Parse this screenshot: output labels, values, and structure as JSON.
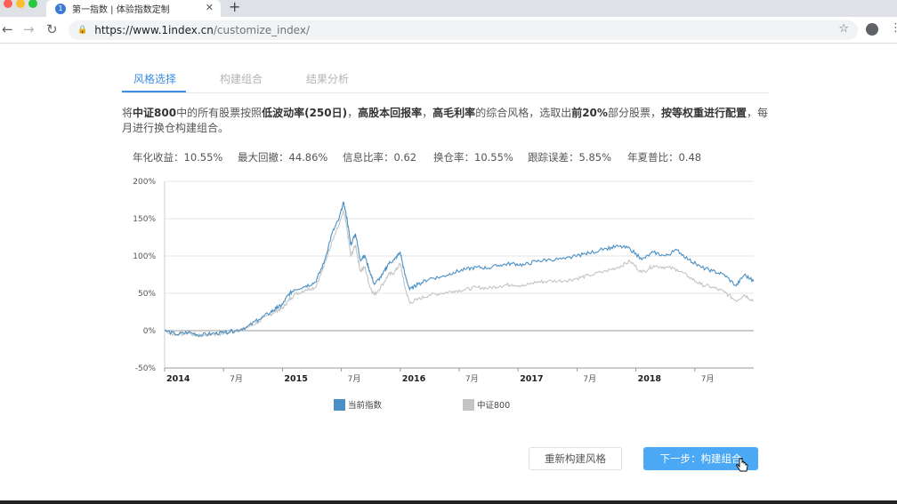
{
  "browser": {
    "tab_title": "第一指数 | 体验指数定制",
    "favicon_letter": "1",
    "new_tab": "+",
    "close": "✕",
    "url_host": "https://www.1index.cn",
    "url_path": "/customize_index/"
  },
  "page_tabs": [
    {
      "label": "风格选择",
      "active": true
    },
    {
      "label": "构建组合",
      "active": false
    },
    {
      "label": "结果分析",
      "active": false
    }
  ],
  "description": {
    "p1": "将",
    "b1": "中证800",
    "p2": "中的所有股票按照",
    "b2": "低波动率(250日)",
    "p3": "，",
    "b3": "高股本回报率",
    "p4": "，",
    "b4": "高毛利率",
    "p5": "的综合风格，选取出",
    "b5": "前20%",
    "p6": "部分股票，",
    "b6": "按等权重进行配置",
    "p7": "，每月进行换仓构建组合。"
  },
  "stats": [
    "年化收益：10.55%",
    "最大回撤：44.86%",
    "信息比率：0.62",
    "换仓率：10.55%",
    "跟踪误差：5.85%",
    "年夏普比：0.48"
  ],
  "chart_data": {
    "type": "line",
    "y_ticks": [
      "200%",
      "150%",
      "100%",
      "50%",
      "0%",
      "-50%"
    ],
    "ylim": [
      -50,
      200
    ],
    "x_ticks": [
      {
        "label": "2014",
        "bold": true,
        "t": 0
      },
      {
        "label": "7月",
        "bold": false,
        "t": 0.5
      },
      {
        "label": "2015",
        "bold": true,
        "t": 1
      },
      {
        "label": "7月",
        "bold": false,
        "t": 1.5
      },
      {
        "label": "2016",
        "bold": true,
        "t": 2
      },
      {
        "label": "7月",
        "bold": false,
        "t": 2.5
      },
      {
        "label": "2017",
        "bold": true,
        "t": 3
      },
      {
        "label": "7月",
        "bold": false,
        "t": 3.5
      },
      {
        "label": "2018",
        "bold": true,
        "t": 4
      },
      {
        "label": "7月",
        "bold": false,
        "t": 4.5
      }
    ],
    "x_range_years": [
      0,
      5
    ],
    "series": [
      {
        "name": "当前指数",
        "color": "#4a90c4",
        "points": [
          [
            0,
            0
          ],
          [
            0.1,
            -5
          ],
          [
            0.2,
            -2
          ],
          [
            0.3,
            -6
          ],
          [
            0.4,
            -4
          ],
          [
            0.5,
            -3
          ],
          [
            0.6,
            0
          ],
          [
            0.7,
            5
          ],
          [
            0.8,
            15
          ],
          [
            0.9,
            25
          ],
          [
            0.95,
            30
          ],
          [
            1.0,
            35
          ],
          [
            1.05,
            48
          ],
          [
            1.1,
            55
          ],
          [
            1.2,
            60
          ],
          [
            1.28,
            65
          ],
          [
            1.35,
            90
          ],
          [
            1.42,
            130
          ],
          [
            1.48,
            150
          ],
          [
            1.52,
            172
          ],
          [
            1.55,
            148
          ],
          [
            1.58,
            115
          ],
          [
            1.62,
            130
          ],
          [
            1.66,
            95
          ],
          [
            1.7,
            100
          ],
          [
            1.74,
            80
          ],
          [
            1.78,
            62
          ],
          [
            1.85,
            75
          ],
          [
            1.9,
            90
          ],
          [
            1.95,
            95
          ],
          [
            2.0,
            105
          ],
          [
            2.04,
            75
          ],
          [
            2.08,
            55
          ],
          [
            2.15,
            62
          ],
          [
            2.25,
            70
          ],
          [
            2.35,
            72
          ],
          [
            2.45,
            78
          ],
          [
            2.55,
            82
          ],
          [
            2.65,
            85
          ],
          [
            2.75,
            84
          ],
          [
            2.85,
            88
          ],
          [
            2.95,
            90
          ],
          [
            3.05,
            88
          ],
          [
            3.15,
            93
          ],
          [
            3.25,
            95
          ],
          [
            3.4,
            96
          ],
          [
            3.5,
            100
          ],
          [
            3.6,
            104
          ],
          [
            3.75,
            110
          ],
          [
            3.85,
            113
          ],
          [
            3.95,
            110
          ],
          [
            4.05,
            95
          ],
          [
            4.15,
            105
          ],
          [
            4.25,
            100
          ],
          [
            4.35,
            108
          ],
          [
            4.45,
            95
          ],
          [
            4.55,
            85
          ],
          [
            4.65,
            80
          ],
          [
            4.75,
            75
          ],
          [
            4.85,
            60
          ],
          [
            4.92,
            75
          ],
          [
            5.0,
            66
          ]
        ]
      },
      {
        "name": "中证800",
        "color": "#c4c4c4",
        "points": [
          [
            0,
            0
          ],
          [
            0.1,
            -6
          ],
          [
            0.2,
            -3
          ],
          [
            0.3,
            -7
          ],
          [
            0.4,
            -5
          ],
          [
            0.5,
            -4
          ],
          [
            0.6,
            -1
          ],
          [
            0.7,
            4
          ],
          [
            0.8,
            12
          ],
          [
            0.9,
            22
          ],
          [
            0.95,
            27
          ],
          [
            1.0,
            30
          ],
          [
            1.05,
            40
          ],
          [
            1.1,
            48
          ],
          [
            1.2,
            55
          ],
          [
            1.28,
            58
          ],
          [
            1.35,
            85
          ],
          [
            1.42,
            120
          ],
          [
            1.48,
            142
          ],
          [
            1.52,
            160
          ],
          [
            1.55,
            135
          ],
          [
            1.58,
            100
          ],
          [
            1.62,
            115
          ],
          [
            1.66,
            80
          ],
          [
            1.7,
            85
          ],
          [
            1.74,
            60
          ],
          [
            1.78,
            48
          ],
          [
            1.85,
            62
          ],
          [
            1.9,
            75
          ],
          [
            1.95,
            78
          ],
          [
            2.0,
            90
          ],
          [
            2.04,
            58
          ],
          [
            2.08,
            37
          ],
          [
            2.15,
            42
          ],
          [
            2.25,
            48
          ],
          [
            2.35,
            50
          ],
          [
            2.45,
            53
          ],
          [
            2.55,
            55
          ],
          [
            2.65,
            58
          ],
          [
            2.75,
            57
          ],
          [
            2.85,
            60
          ],
          [
            2.95,
            62
          ],
          [
            3.05,
            60
          ],
          [
            3.15,
            65
          ],
          [
            3.25,
            66
          ],
          [
            3.4,
            67
          ],
          [
            3.5,
            70
          ],
          [
            3.6,
            74
          ],
          [
            3.75,
            80
          ],
          [
            3.85,
            85
          ],
          [
            3.95,
            93
          ],
          [
            4.05,
            78
          ],
          [
            4.15,
            87
          ],
          [
            4.25,
            85
          ],
          [
            4.35,
            82
          ],
          [
            4.45,
            72
          ],
          [
            4.55,
            62
          ],
          [
            4.65,
            58
          ],
          [
            4.75,
            52
          ],
          [
            4.85,
            40
          ],
          [
            4.92,
            48
          ],
          [
            5.0,
            40
          ]
        ]
      }
    ]
  },
  "legend": {
    "current": {
      "label": "当前指数",
      "color": "#4a90c4"
    },
    "benchmark": {
      "label": "中证800",
      "color": "#c4c4c4"
    }
  },
  "buttons": {
    "reset": "重新构建风格",
    "next": "下一步：构建组合"
  }
}
